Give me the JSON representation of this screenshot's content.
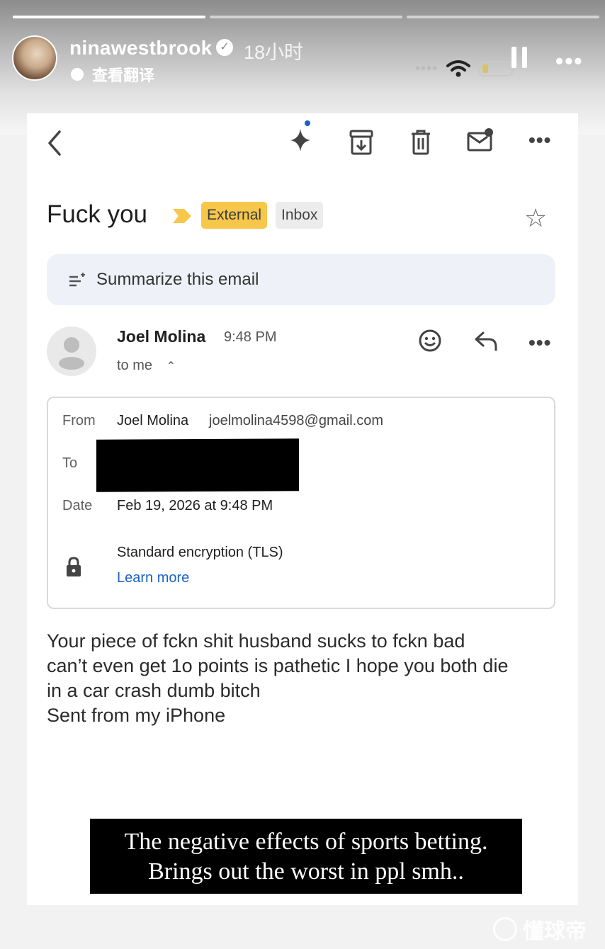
{
  "story": {
    "progress_segments": 3,
    "active_segment": 0,
    "username": "ninawestbrook",
    "time": "18小时",
    "translate_label": "查看翻译"
  },
  "email": {
    "subject": "Fuck you",
    "labels": [
      "External",
      "Inbox"
    ],
    "summarize_label": "Summarize this email",
    "sender_name": "Joel Molina",
    "sent_time": "9:48 PM",
    "recipient_summary": "to me",
    "details": {
      "from_label": "From",
      "from_name": "Joel Molina",
      "from_email": "joelmolina4598@gmail.com",
      "to_label": "To",
      "date_label": "Date",
      "date_value": "Feb 19, 2026 at 9:48 PM",
      "encryption": "Standard encryption (TLS)",
      "learn_more": "Learn more"
    },
    "body_lines": [
      "Your piece of fckn shit husband sucks to fckn bad",
      "can’t even get 1o points is pathetic I hope you both die",
      "in a car crash dumb bitch",
      "Sent from my iPhone"
    ]
  },
  "caption": {
    "line1": "The negative effects of sports betting.",
    "line2": "Brings out the worst in ppl smh.."
  },
  "watermark": "懂球帝",
  "colors": {
    "external_chip": "#f6c74a",
    "link": "#1a63c5",
    "gemini_dot": "#1a63c5"
  }
}
